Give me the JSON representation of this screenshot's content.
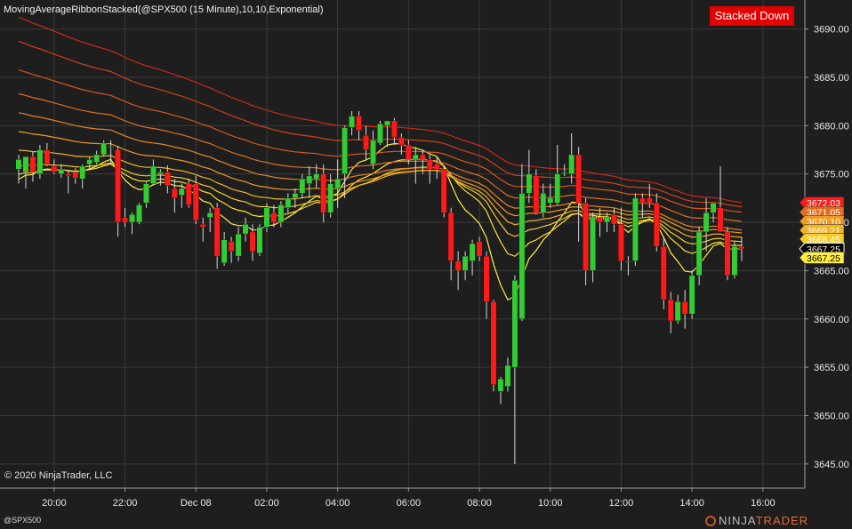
{
  "header": {
    "indicator_title": "MovingAverageRibbonStacked(@SPX500 (15 Minute),10,10,Exponential)",
    "status_badge": "Stacked Down"
  },
  "footer": {
    "copyright": "© 2020 NinjaTrader, LLC",
    "instrument": "@SPX500",
    "brand_part1": "NINJA",
    "brand_part2": "TRADER"
  },
  "colors": {
    "background": "#1e1e1e",
    "grid": "#3a3a3a",
    "up_candle": "#33cc33",
    "down_candle": "#ff1a1a",
    "wick": "#d8d8d8",
    "badge": "#e00000",
    "ribbon": [
      "#ffee44",
      "#ffe033",
      "#f5cc2a",
      "#f0b424",
      "#ee9a22",
      "#e88520",
      "#e06e1e",
      "#d8571c",
      "#d0401a",
      "#c82a18"
    ]
  },
  "chart_data": {
    "type": "candlestick",
    "title": "MovingAverageRibbonStacked(@SPX500 (15 Minute),10,10,Exponential)",
    "ylim": [
      3642.5,
      3693
    ],
    "y_ticks": [
      "3645.00",
      "3650.00",
      "3655.00",
      "3660.00",
      "3665.00",
      "3670.00",
      "3675.00",
      "3680.00",
      "3685.00",
      "3690.00"
    ],
    "x_ticks": [
      {
        "label": "20:00",
        "bar": 5
      },
      {
        "label": "22:00",
        "bar": 15
      },
      {
        "label": "Dec 08",
        "bar": 25
      },
      {
        "label": "02:00",
        "bar": 35
      },
      {
        "label": "04:00",
        "bar": 45
      },
      {
        "label": "06:00",
        "bar": 55
      },
      {
        "label": "08:00",
        "bar": 65
      },
      {
        "label": "10:00",
        "bar": 75
      },
      {
        "label": "12:00",
        "bar": 85
      },
      {
        "label": "14:00",
        "bar": 95
      },
      {
        "label": "16:00",
        "bar": 105
      }
    ],
    "candles": [
      {
        "o": 3675.5,
        "h": 3677.0,
        "l": 3674.0,
        "c": 3676.5
      },
      {
        "o": 3675.2,
        "h": 3676.8,
        "l": 3673.5,
        "c": 3676.8
      },
      {
        "o": 3676.8,
        "h": 3677.3,
        "l": 3674.2,
        "c": 3675.2
      },
      {
        "o": 3675.0,
        "h": 3678.0,
        "l": 3674.5,
        "c": 3677.5
      },
      {
        "o": 3677.5,
        "h": 3678.2,
        "l": 3675.8,
        "c": 3676.0
      },
      {
        "o": 3675.8,
        "h": 3676.5,
        "l": 3675.0,
        "c": 3675.2
      },
      {
        "o": 3675.0,
        "h": 3676.0,
        "l": 3674.6,
        "c": 3675.5
      },
      {
        "o": 3675.0,
        "h": 3675.4,
        "l": 3673.0,
        "c": 3674.8
      },
      {
        "o": 3675.2,
        "h": 3675.6,
        "l": 3674.0,
        "c": 3674.6
      },
      {
        "o": 3674.5,
        "h": 3676.0,
        "l": 3673.5,
        "c": 3675.8
      },
      {
        "o": 3676.0,
        "h": 3676.8,
        "l": 3675.5,
        "c": 3676.5
      },
      {
        "o": 3676.2,
        "h": 3677.4,
        "l": 3676.0,
        "c": 3677.0
      },
      {
        "o": 3677.0,
        "h": 3678.5,
        "l": 3676.8,
        "c": 3678.2
      },
      {
        "o": 3677.8,
        "h": 3678.5,
        "l": 3676.0,
        "c": 3677.8
      },
      {
        "o": 3677.5,
        "h": 3677.9,
        "l": 3668.5,
        "c": 3670.0
      },
      {
        "o": 3670.5,
        "h": 3671.5,
        "l": 3669.5,
        "c": 3670.0
      },
      {
        "o": 3670.0,
        "h": 3671.0,
        "l": 3668.8,
        "c": 3670.8
      },
      {
        "o": 3670.0,
        "h": 3672.0,
        "l": 3669.8,
        "c": 3671.8
      },
      {
        "o": 3672.0,
        "h": 3674.2,
        "l": 3671.5,
        "c": 3674.0
      },
      {
        "o": 3674.0,
        "h": 3676.5,
        "l": 3673.8,
        "c": 3675.8
      },
      {
        "o": 3675.0,
        "h": 3675.5,
        "l": 3673.8,
        "c": 3675.2
      },
      {
        "o": 3675.2,
        "h": 3675.9,
        "l": 3673.0,
        "c": 3673.8
      },
      {
        "o": 3673.5,
        "h": 3674.5,
        "l": 3671.0,
        "c": 3672.5
      },
      {
        "o": 3672.8,
        "h": 3674.0,
        "l": 3671.5,
        "c": 3673.5
      },
      {
        "o": 3674.0,
        "h": 3674.5,
        "l": 3671.5,
        "c": 3671.8
      },
      {
        "o": 3674.0,
        "h": 3674.8,
        "l": 3669.8,
        "c": 3670.2
      },
      {
        "o": 3669.8,
        "h": 3670.5,
        "l": 3668.0,
        "c": 3669.5
      },
      {
        "o": 3670.5,
        "h": 3671.5,
        "l": 3669.0,
        "c": 3671.0
      },
      {
        "o": 3671.5,
        "h": 3672.0,
        "l": 3665.2,
        "c": 3666.5
      },
      {
        "o": 3665.8,
        "h": 3669.0,
        "l": 3665.5,
        "c": 3668.2
      },
      {
        "o": 3668.0,
        "h": 3668.5,
        "l": 3665.8,
        "c": 3667.0
      },
      {
        "o": 3666.5,
        "h": 3669.5,
        "l": 3666.0,
        "c": 3668.8
      },
      {
        "o": 3668.8,
        "h": 3670.5,
        "l": 3668.0,
        "c": 3669.8
      },
      {
        "o": 3669.0,
        "h": 3669.8,
        "l": 3666.0,
        "c": 3667.0
      },
      {
        "o": 3666.8,
        "h": 3669.8,
        "l": 3666.5,
        "c": 3669.5
      },
      {
        "o": 3669.5,
        "h": 3672.0,
        "l": 3669.0,
        "c": 3671.5
      },
      {
        "o": 3671.0,
        "h": 3671.8,
        "l": 3669.5,
        "c": 3670.0
      },
      {
        "o": 3670.0,
        "h": 3672.2,
        "l": 3669.5,
        "c": 3671.8
      },
      {
        "o": 3671.5,
        "h": 3673.0,
        "l": 3671.0,
        "c": 3672.5
      },
      {
        "o": 3672.5,
        "h": 3673.5,
        "l": 3671.5,
        "c": 3673.0
      },
      {
        "o": 3673.0,
        "h": 3675.0,
        "l": 3672.5,
        "c": 3674.5
      },
      {
        "o": 3674.0,
        "h": 3675.8,
        "l": 3672.5,
        "c": 3674.8
      },
      {
        "o": 3674.5,
        "h": 3676.0,
        "l": 3673.5,
        "c": 3675.0
      },
      {
        "o": 3675.0,
        "h": 3676.0,
        "l": 3670.0,
        "c": 3671.0
      },
      {
        "o": 3671.0,
        "h": 3675.0,
        "l": 3670.5,
        "c": 3674.0
      },
      {
        "o": 3673.5,
        "h": 3676.5,
        "l": 3671.5,
        "c": 3674.5
      },
      {
        "o": 3675.0,
        "h": 3680.0,
        "l": 3672.5,
        "c": 3679.8
      },
      {
        "o": 3679.8,
        "h": 3681.5,
        "l": 3679.0,
        "c": 3681.0
      },
      {
        "o": 3681.0,
        "h": 3681.5,
        "l": 3678.5,
        "c": 3679.5
      },
      {
        "o": 3679.0,
        "h": 3680.0,
        "l": 3676.5,
        "c": 3677.5
      },
      {
        "o": 3676.0,
        "h": 3679.5,
        "l": 3675.5,
        "c": 3678.5
      },
      {
        "o": 3678.2,
        "h": 3680.5,
        "l": 3678.0,
        "c": 3680.2
      },
      {
        "o": 3680.0,
        "h": 3680.5,
        "l": 3677.8,
        "c": 3680.5
      },
      {
        "o": 3680.5,
        "h": 3680.8,
        "l": 3678.0,
        "c": 3678.8
      },
      {
        "o": 3678.8,
        "h": 3679.2,
        "l": 3677.0,
        "c": 3678.0
      },
      {
        "o": 3678.0,
        "h": 3678.5,
        "l": 3676.0,
        "c": 3676.5
      },
      {
        "o": 3676.5,
        "h": 3677.8,
        "l": 3674.0,
        "c": 3677.0
      },
      {
        "o": 3677.0,
        "h": 3677.5,
        "l": 3675.0,
        "c": 3676.5
      },
      {
        "o": 3676.5,
        "h": 3677.0,
        "l": 3674.0,
        "c": 3675.5
      },
      {
        "o": 3676.0,
        "h": 3676.8,
        "l": 3674.5,
        "c": 3675.5
      },
      {
        "o": 3675.5,
        "h": 3675.8,
        "l": 3670.5,
        "c": 3671.0
      },
      {
        "o": 3671.0,
        "h": 3671.5,
        "l": 3664.0,
        "c": 3666.0
      },
      {
        "o": 3666.0,
        "h": 3667.0,
        "l": 3663.0,
        "c": 3665.0
      },
      {
        "o": 3665.0,
        "h": 3667.0,
        "l": 3664.0,
        "c": 3666.5
      },
      {
        "o": 3666.0,
        "h": 3668.2,
        "l": 3664.5,
        "c": 3667.8
      },
      {
        "o": 3668.0,
        "h": 3668.5,
        "l": 3666.0,
        "c": 3666.5
      },
      {
        "o": 3666.5,
        "h": 3667.0,
        "l": 3660.0,
        "c": 3661.8
      },
      {
        "o": 3661.8,
        "h": 3662.0,
        "l": 3652.5,
        "c": 3653.2
      },
      {
        "o": 3652.5,
        "h": 3654.0,
        "l": 3651.2,
        "c": 3653.8
      },
      {
        "o": 3653.0,
        "h": 3656.0,
        "l": 3652.5,
        "c": 3655.2
      },
      {
        "o": 3655.0,
        "h": 3664.5,
        "l": 3645.0,
        "c": 3664.0
      },
      {
        "o": 3660.0,
        "h": 3676.0,
        "l": 3659.8,
        "c": 3673.0
      },
      {
        "o": 3673.0,
        "h": 3677.5,
        "l": 3672.0,
        "c": 3675.0
      },
      {
        "o": 3674.8,
        "h": 3675.5,
        "l": 3670.8,
        "c": 3671.0
      },
      {
        "o": 3671.0,
        "h": 3674.0,
        "l": 3670.5,
        "c": 3673.0
      },
      {
        "o": 3672.0,
        "h": 3674.0,
        "l": 3671.5,
        "c": 3672.5
      },
      {
        "o": 3672.0,
        "h": 3678.0,
        "l": 3671.8,
        "c": 3675.0
      },
      {
        "o": 3675.2,
        "h": 3676.0,
        "l": 3674.8,
        "c": 3675.2
      },
      {
        "o": 3675.0,
        "h": 3679.2,
        "l": 3674.0,
        "c": 3677.0
      },
      {
        "o": 3677.0,
        "h": 3677.8,
        "l": 3668.0,
        "c": 3672.0
      },
      {
        "o": 3672.0,
        "h": 3672.5,
        "l": 3663.5,
        "c": 3665.0
      },
      {
        "o": 3665.0,
        "h": 3671.0,
        "l": 3663.8,
        "c": 3670.5
      },
      {
        "o": 3670.5,
        "h": 3671.5,
        "l": 3668.5,
        "c": 3670.0
      },
      {
        "o": 3670.0,
        "h": 3671.0,
        "l": 3669.0,
        "c": 3670.5
      },
      {
        "o": 3670.8,
        "h": 3671.5,
        "l": 3669.0,
        "c": 3669.8
      },
      {
        "o": 3669.8,
        "h": 3671.5,
        "l": 3665.0,
        "c": 3666.0
      },
      {
        "o": 3666.0,
        "h": 3666.5,
        "l": 3664.5,
        "c": 3666.0
      },
      {
        "o": 3666.0,
        "h": 3673.0,
        "l": 3665.5,
        "c": 3672.5
      },
      {
        "o": 3672.5,
        "h": 3673.0,
        "l": 3670.5,
        "c": 3672.0
      },
      {
        "o": 3672.5,
        "h": 3674.0,
        "l": 3671.5,
        "c": 3672.0
      },
      {
        "o": 3672.0,
        "h": 3673.0,
        "l": 3667.0,
        "c": 3667.5
      },
      {
        "o": 3667.5,
        "h": 3668.5,
        "l": 3661.0,
        "c": 3662.0
      },
      {
        "o": 3662.0,
        "h": 3662.8,
        "l": 3658.5,
        "c": 3659.8
      },
      {
        "o": 3659.8,
        "h": 3662.5,
        "l": 3659.5,
        "c": 3661.8
      },
      {
        "o": 3661.8,
        "h": 3663.0,
        "l": 3659.0,
        "c": 3660.5
      },
      {
        "o": 3660.5,
        "h": 3665.0,
        "l": 3660.0,
        "c": 3664.5
      },
      {
        "o": 3664.5,
        "h": 3669.5,
        "l": 3663.5,
        "c": 3669.0
      },
      {
        "o": 3669.0,
        "h": 3672.5,
        "l": 3667.0,
        "c": 3671.0
      },
      {
        "o": 3671.0,
        "h": 3672.0,
        "l": 3670.0,
        "c": 3672.0
      },
      {
        "o": 3671.5,
        "h": 3675.8,
        "l": 3670.0,
        "c": 3669.0
      },
      {
        "o": 3669.0,
        "h": 3669.5,
        "l": 3664.0,
        "c": 3664.5
      },
      {
        "o": 3664.5,
        "h": 3668.0,
        "l": 3664.2,
        "c": 3667.5
      },
      {
        "o": 3667.5,
        "h": 3668.5,
        "l": 3666.0,
        "c": 3667.25
      }
    ],
    "ma_ribbon_endpoints": [
      {
        "name": "MA1",
        "start": 3674.0,
        "end": 3667.25
      },
      {
        "name": "MA2",
        "start": 3674.8,
        "end": 3667.6
      },
      {
        "name": "MA3",
        "start": 3675.8,
        "end": 3668.0
      },
      {
        "name": "MA4",
        "start": 3677.5,
        "end": 3668.45
      },
      {
        "name": "MA5",
        "start": 3679.5,
        "end": 3668.9
      },
      {
        "name": "MA6",
        "start": 3681.5,
        "end": 3669.21
      },
      {
        "name": "MA7",
        "start": 3683.5,
        "end": 3670.1
      },
      {
        "name": "MA8",
        "start": 3686.0,
        "end": 3671.05
      },
      {
        "name": "MA9",
        "start": 3689.0,
        "end": 3671.6
      },
      {
        "name": "MA10",
        "start": 3691.5,
        "end": 3672.03
      }
    ],
    "price_labels": [
      {
        "text": "3672.03",
        "value": 3672.03,
        "color": "#ff1a1a",
        "text_color": "#ffffff"
      },
      {
        "text": "3671.05",
        "value": 3671.05,
        "color": "#e06e1e",
        "text_color": "#ffffff"
      },
      {
        "text": "3670.10",
        "value": 3670.1,
        "color": "#ee9a22",
        "text_color": "#ffffff"
      },
      {
        "text": "3669.21",
        "value": 3669.21,
        "color": "#f0b424",
        "text_color": "#ffffff"
      },
      {
        "text": "3668.45",
        "value": 3668.45,
        "color": "#f5cc2a",
        "text_color": "#ffffff"
      },
      {
        "text": "3667.25",
        "value": 3667.25,
        "color": "#000000",
        "text_color": "#ffffff",
        "border": "#ffffff"
      },
      {
        "text": "3667.25",
        "value": 3667.0,
        "color": "#ffee44",
        "text_color": "#000000"
      }
    ]
  }
}
